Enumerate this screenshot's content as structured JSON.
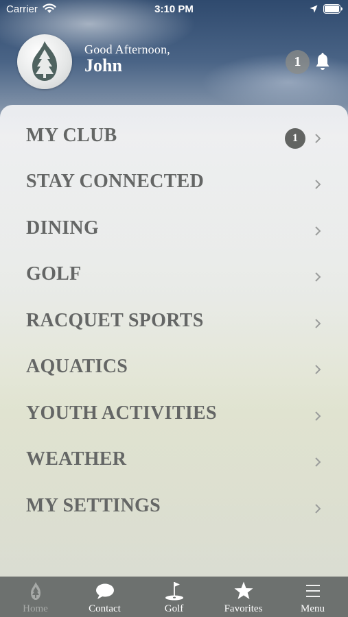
{
  "status_bar": {
    "carrier": "Carrier",
    "time": "3:10 PM"
  },
  "header": {
    "greeting": "Good Afternoon,",
    "name": "John",
    "notification_count": "1"
  },
  "menu": [
    {
      "label": "MY CLUB",
      "badge": "1"
    },
    {
      "label": "STAY CONNECTED"
    },
    {
      "label": "DINING"
    },
    {
      "label": "GOLF"
    },
    {
      "label": "RACQUET SPORTS"
    },
    {
      "label": "AQUATICS"
    },
    {
      "label": "YOUTH ACTIVITIES"
    },
    {
      "label": "WEATHER"
    },
    {
      "label": "MY SETTINGS"
    }
  ],
  "tabs": [
    {
      "label": "Home",
      "icon": "flame-tree-icon",
      "active": false
    },
    {
      "label": "Contact",
      "icon": "chat-bubble-icon",
      "active": true
    },
    {
      "label": "Golf",
      "icon": "golf-flag-icon",
      "active": true
    },
    {
      "label": "Favorites",
      "icon": "star-icon",
      "active": true
    },
    {
      "label": "Menu",
      "icon": "hamburger-icon",
      "active": true
    }
  ],
  "colors": {
    "tab_bar": "#6d716f",
    "menu_text": "#646665",
    "badge": "#626462"
  }
}
